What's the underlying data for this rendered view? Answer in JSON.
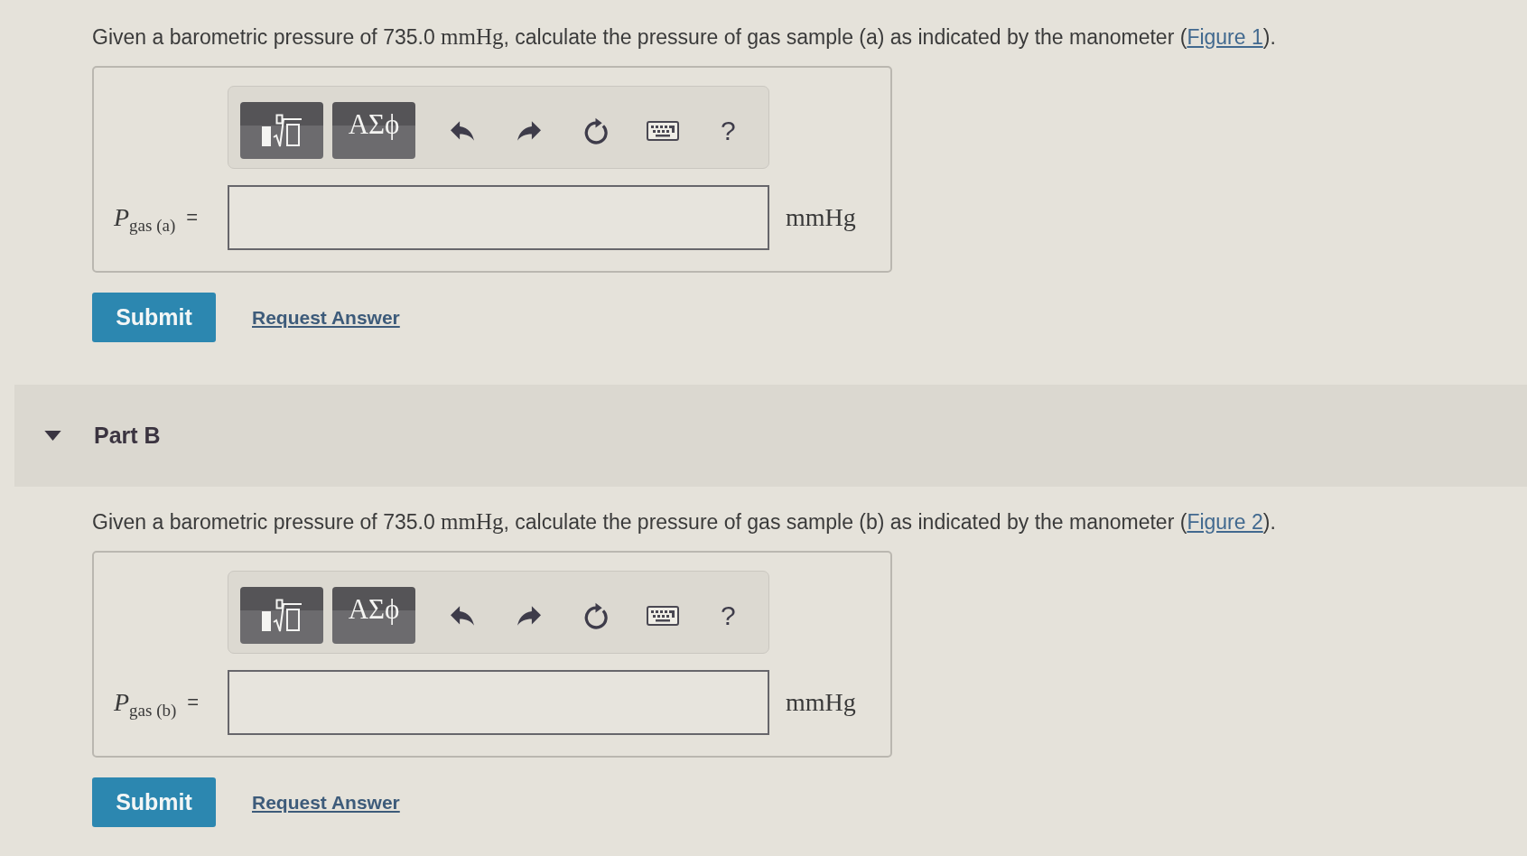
{
  "parts": [
    {
      "question": [
        {
          "kind": "text",
          "text": "Given a barometric pressure of 735.0 "
        },
        {
          "kind": "math",
          "text": "mmHg"
        },
        {
          "kind": "text",
          "text": ", calculate the pressure of gas sample (a) as indicated by the manometer ("
        },
        {
          "kind": "link",
          "text": "Figure 1"
        },
        {
          "kind": "text",
          "text": ")."
        }
      ],
      "toolbar": [
        {
          "kind": "template"
        },
        {
          "kind": "symbols",
          "label": "ΑΣϕ"
        },
        {
          "kind": "undo"
        },
        {
          "kind": "redo"
        },
        {
          "kind": "reset"
        },
        {
          "kind": "keyboard"
        },
        {
          "kind": "help",
          "label": "?"
        }
      ],
      "answer": {
        "variable": "*P*$_{gas (a)}$",
        "equals": "=",
        "unit": "mmHg"
      },
      "actions": {
        "submit": "Submit",
        "request_answer": "Request Answer"
      }
    },
    {
      "header": {
        "title": "Part B",
        "expanded": true
      },
      "question": [
        {
          "kind": "text",
          "text": "Given a barometric pressure of 735.0 "
        },
        {
          "kind": "math",
          "text": "mmHg"
        },
        {
          "kind": "text",
          "text": ", calculate the pressure of gas sample (b) as indicated by the manometer ("
        },
        {
          "kind": "link",
          "text": "Figure 2"
        },
        {
          "kind": "text",
          "text": ")."
        }
      ],
      "toolbar": [
        {
          "kind": "template"
        },
        {
          "kind": "symbols",
          "label": "ΑΣϕ"
        },
        {
          "kind": "undo"
        },
        {
          "kind": "redo"
        },
        {
          "kind": "reset"
        },
        {
          "kind": "keyboard"
        },
        {
          "kind": "help",
          "label": "?"
        }
      ],
      "answer": {
        "variable": "*P*$_{gas (b)}$",
        "equals": "=",
        "unit": "mmHg"
      },
      "actions": {
        "submit": "Submit",
        "request_answer": "Request Answer"
      }
    }
  ]
}
